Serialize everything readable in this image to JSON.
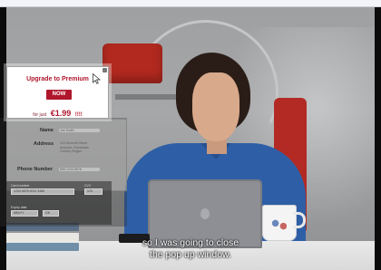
{
  "popup": {
    "title": "Upgrade to Premium",
    "cta_label": "NOW",
    "price_prefix": "for just",
    "price": "€1.99",
    "price_suffix": "!!!!"
  },
  "form": {
    "name_label": "Name",
    "name_placeholder": "Joe Smith",
    "address_label": "Address",
    "address_value": "123 Seventh Street Anytown, Somestate Country Region",
    "phone_label": "Phone Number",
    "phone_placeholder": "555-1234-5678",
    "card_number_label": "Card number",
    "card_number_placeholder": "1234 5678 9012 3456",
    "cvv_label": "CVV",
    "cvv_placeholder": "123",
    "expiry_label": "Expiry date",
    "expiry_month_placeholder": "MM/YY",
    "expiry_button_label": "OK"
  },
  "subtitle": {
    "line1": "so I was going to close",
    "line2": "the pop up window."
  },
  "colors": {
    "brand_red": "#b0172d",
    "shirt_blue": "#2e5fa6"
  }
}
